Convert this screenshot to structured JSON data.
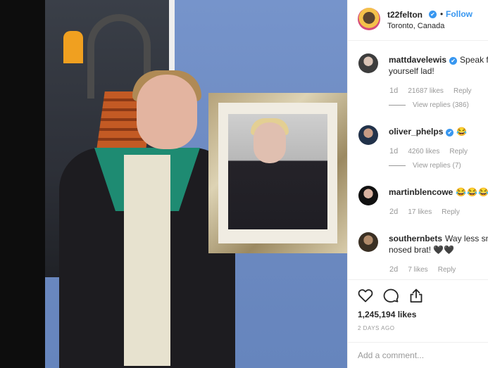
{
  "post": {
    "username": "t22felton",
    "verified_mark": "✔",
    "separator": "•",
    "follow_label": "Follow",
    "location": "Toronto, Canada"
  },
  "comments": [
    {
      "username": "mattdavelewis",
      "verified": true,
      "text_line1": "Speak f",
      "text_line2": "yourself lad!",
      "time": "1d",
      "likes": "21687 likes",
      "reply_label": "Reply",
      "view_replies": "View replies (386)",
      "avatar_icon": "mattdavelewis-avatar"
    },
    {
      "username": "oliver_phelps",
      "verified": true,
      "text_line1": "😂",
      "time": "1d",
      "likes": "4260 likes",
      "reply_label": "Reply",
      "view_replies": "View replies (7)",
      "avatar_icon": "oliver-phelps-avatar"
    },
    {
      "username": "martinblencowe",
      "verified": false,
      "text_line1": "😂😂😂",
      "time": "2d",
      "likes": "17 likes",
      "reply_label": "Reply",
      "avatar_icon": "martinblencowe-avatar"
    },
    {
      "username": "southernbets",
      "verified": false,
      "text_line1": "Way less sn",
      "text_line2": "nosed brat! 🖤🖤",
      "time": "2d",
      "likes": "7 likes",
      "reply_label": "Reply",
      "avatar_icon": "southernbets-avatar"
    }
  ],
  "actions": {
    "like_icon": "heart-icon",
    "comment_icon": "comment-bubble-icon",
    "share_icon": "share-icon",
    "like_count": "1,245,194 likes",
    "time_ago": "2 DAYS AGO"
  },
  "add_comment": {
    "placeholder": "Add a comment..."
  },
  "colors": {
    "accent": "#3897f0",
    "muted": "#999999",
    "text": "#262626"
  }
}
